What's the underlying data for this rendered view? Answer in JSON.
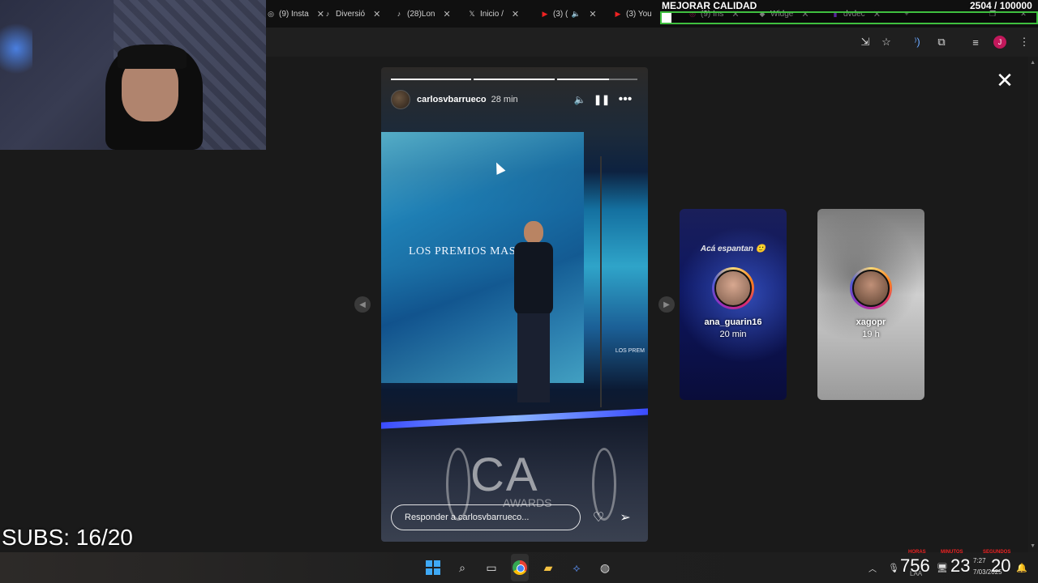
{
  "browser": {
    "tabs": [
      {
        "label": "(9) Insta",
        "icon": "instagram-icon"
      },
      {
        "label": "Diversió",
        "icon": "tiktok-icon"
      },
      {
        "label": "(28)Lon",
        "icon": "tiktok-icon"
      },
      {
        "label": "Inicio /",
        "icon": "x-icon"
      },
      {
        "label": "(3) (",
        "icon": "youtube-icon"
      },
      {
        "label": "(3) You",
        "icon": "youtube-icon"
      }
    ],
    "extra_tabs": [
      {
        "label": "(9) Ins"
      },
      {
        "label": "Widge"
      },
      {
        "label": "dvdec"
      }
    ],
    "profile_initial": "J"
  },
  "overlay": {
    "quality_label": "MEJORAR CALIDAD",
    "goal_count": "2504 / 100000",
    "goal_progress": 0.025,
    "subs_label": "SUBS: 16/20"
  },
  "story": {
    "username": "carlosvbarrueco",
    "time_ago": "28 min",
    "banner_text": "LOS PREMIOS MAS Pica",
    "small_text": "LOS PREM",
    "awards_main": "CA",
    "awards_sub": "AWARDS",
    "reply_placeholder": "Responder a carlosvbarrueco...",
    "progress_segments": [
      1,
      1,
      0.65
    ]
  },
  "side_stories": [
    {
      "caption": "Acá espantan 🙂",
      "username": "ana_guarin16",
      "time_ago": "20 min"
    },
    {
      "caption": "",
      "username": "xagopr",
      "time_ago": "19 h"
    }
  ],
  "taskbar": {
    "clock": {
      "hours": "756",
      "minutes": "23",
      "seconds": "20",
      "hours_label": "HORAS",
      "minutes_label": "MINUTOS",
      "seconds_label": "SEGUNDOS"
    },
    "system_time": "7:27",
    "system_date": "7/03/2025",
    "language": "LAA"
  },
  "colors": {
    "goal_border": "#3fbf3f",
    "background": "#1a1a1a"
  }
}
